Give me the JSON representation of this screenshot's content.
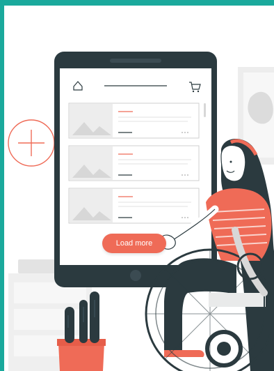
{
  "colors": {
    "teal": "#1aa99c",
    "coral": "#ef6b57",
    "dark": "#2b3a3f",
    "light_gray": "#e9eaea"
  },
  "icons": {
    "home": "home-icon",
    "cart": "cart-icon",
    "plus": "plus-icon",
    "image": "image-placeholder-icon"
  },
  "screen": {
    "load_more_label": "Load more",
    "cards_count_visible": 3
  }
}
